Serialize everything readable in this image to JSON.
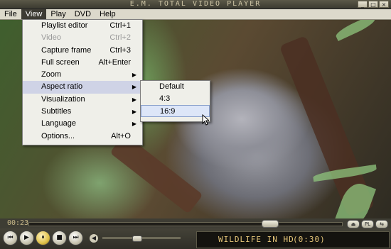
{
  "window": {
    "title": "E.M. TOTAL VIDEO PLAYER",
    "buttons": [
      "_",
      "□",
      "×"
    ]
  },
  "menubar": [
    "File",
    "View",
    "Play",
    "DVD",
    "Help"
  ],
  "view_menu": [
    {
      "label": "Playlist editor",
      "shortcut": "Ctrl+1",
      "disabled": false,
      "submenu": false
    },
    {
      "label": "Video",
      "shortcut": "Ctrl+2",
      "disabled": true,
      "submenu": false
    },
    {
      "label": "Capture frame",
      "shortcut": "Ctrl+3",
      "disabled": false,
      "submenu": false
    },
    {
      "label": "Full screen",
      "shortcut": "Alt+Enter",
      "disabled": false,
      "submenu": false
    },
    {
      "label": "Zoom",
      "shortcut": "",
      "disabled": false,
      "submenu": true
    },
    {
      "label": "Aspect ratio",
      "shortcut": "",
      "disabled": false,
      "submenu": true,
      "highlighted": true
    },
    {
      "label": "Visualization",
      "shortcut": "",
      "disabled": false,
      "submenu": true
    },
    {
      "label": "Subtitles",
      "shortcut": "",
      "disabled": false,
      "submenu": true
    },
    {
      "label": "Language",
      "shortcut": "",
      "disabled": false,
      "submenu": true
    },
    {
      "label": "Options...",
      "shortcut": "Alt+O",
      "disabled": false,
      "submenu": false
    }
  ],
  "aspect_submenu": [
    {
      "label": "Default"
    },
    {
      "label": "4:3"
    },
    {
      "label": "16:9",
      "highlighted": true
    }
  ],
  "player": {
    "time": "00:23",
    "track_name": "WILDLIFE IN HD",
    "duration": "(0:30)",
    "right_buttons": [
      "⏏",
      "PL",
      "⇆"
    ],
    "playback_buttons": [
      "⏮",
      "▶",
      "⏸",
      "■",
      "⏭"
    ]
  },
  "colors": {
    "lcd_text": "#e7c77a",
    "menu_bg": "#efefe9",
    "menubar_active": "#3d3b33"
  }
}
